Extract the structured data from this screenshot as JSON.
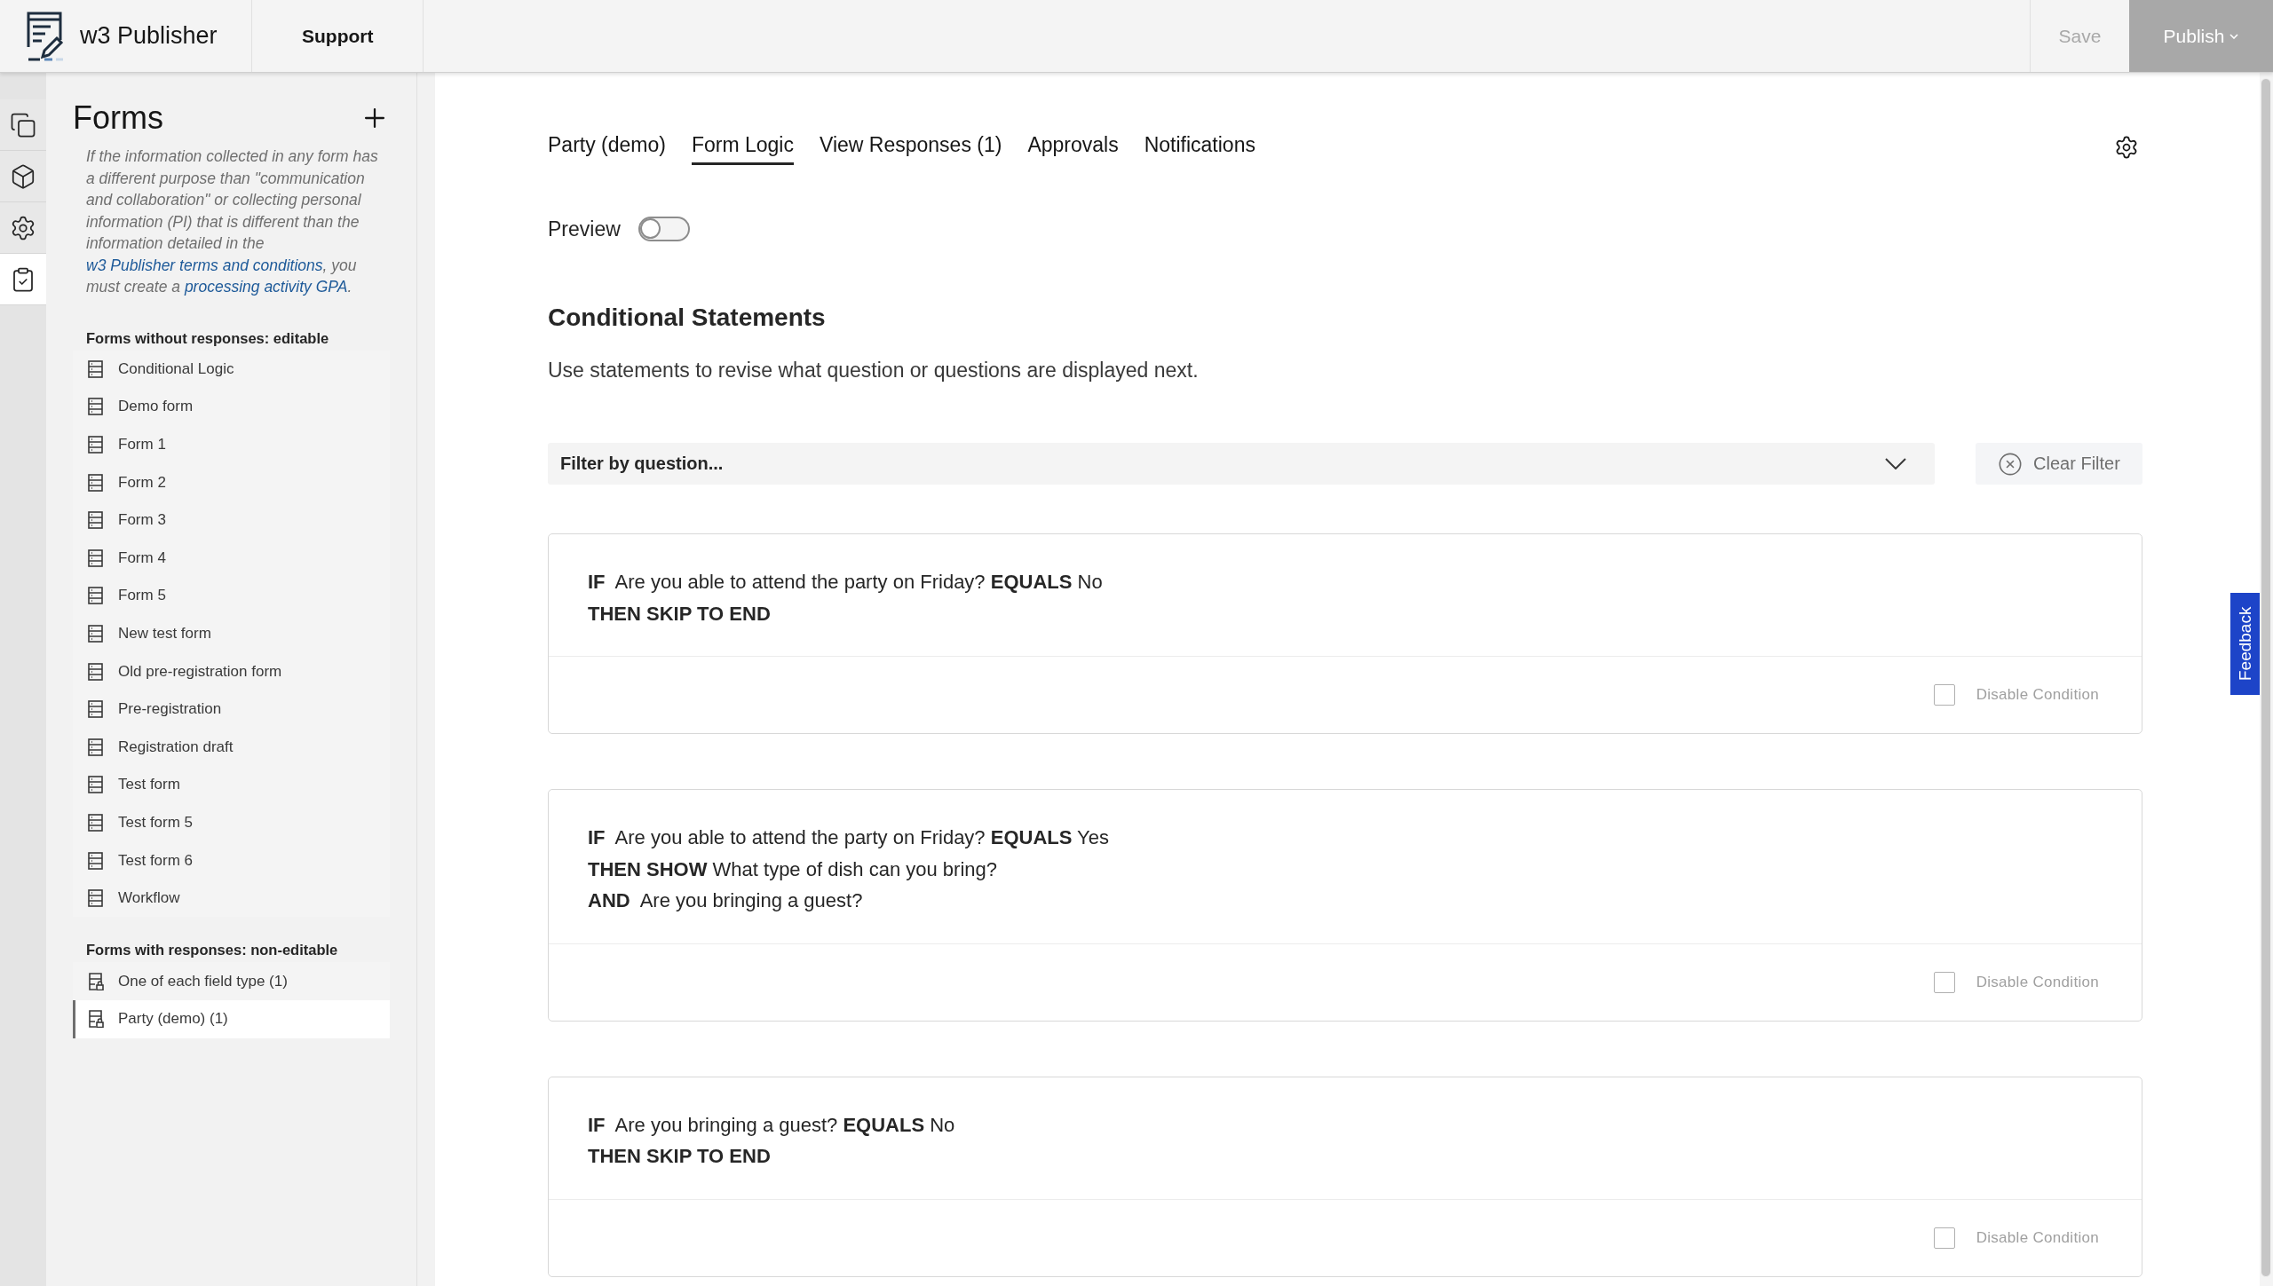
{
  "app": {
    "name": "w3 Publisher"
  },
  "header_nav": [
    {
      "label": "Support"
    }
  ],
  "header_actions": {
    "save": {
      "label": "Save",
      "disabled": true
    },
    "publish": {
      "label": "Publish"
    }
  },
  "rail": [
    {
      "kind": "pages",
      "selected": false
    },
    {
      "kind": "components",
      "selected": false
    },
    {
      "kind": "settings",
      "selected": false
    },
    {
      "kind": "forms",
      "selected": true
    }
  ],
  "sidebar": {
    "title": "Forms",
    "notice": [
      {
        "kind": "plain",
        "text": "If the information collected in any form has a different purpose than \"communication and collaboration\" or collecting personal information (PI) that is different than the information detailed in the "
      },
      {
        "kind": "link",
        "text": "w3 Publisher terms and conditions"
      },
      {
        "kind": "plain",
        "text": ", you must create a "
      },
      {
        "kind": "link",
        "text": "processing activity GPA"
      },
      {
        "kind": "plain",
        "text": "."
      }
    ],
    "sections": [
      {
        "title": "Forms without responses: editable",
        "kind": "editable",
        "items": [
          {
            "label": "Conditional Logic",
            "selected": false
          },
          {
            "label": "Demo form",
            "selected": false
          },
          {
            "label": "Form 1",
            "selected": false
          },
          {
            "label": "Form 2",
            "selected": false
          },
          {
            "label": "Form 3",
            "selected": false
          },
          {
            "label": "Form 4",
            "selected": false
          },
          {
            "label": "Form 5",
            "selected": false
          },
          {
            "label": "New test form",
            "selected": false
          },
          {
            "label": "Old pre-registration form",
            "selected": false
          },
          {
            "label": "Pre-registration",
            "selected": false
          },
          {
            "label": "Registration draft",
            "selected": false
          },
          {
            "label": "Test form",
            "selected": false
          },
          {
            "label": "Test form 5",
            "selected": false
          },
          {
            "label": "Test form 6",
            "selected": false
          },
          {
            "label": "Workflow",
            "selected": false
          }
        ]
      },
      {
        "title": "Forms with responses: non-editable",
        "kind": "locked",
        "items": [
          {
            "label": "One of each field type (1)",
            "selected": false
          },
          {
            "label": "Party (demo) (1)",
            "selected": true
          }
        ]
      }
    ]
  },
  "tabs": [
    {
      "label": "Party (demo)",
      "selected": false
    },
    {
      "label": "Form Logic",
      "selected": true
    },
    {
      "label": "View Responses (1)",
      "selected": false
    },
    {
      "label": "Approvals",
      "selected": false
    },
    {
      "label": "Notifications",
      "selected": false
    }
  ],
  "preview": {
    "label": "Preview",
    "on": false
  },
  "section": {
    "title": "Conditional Statements",
    "description": "Use statements to revise what question or questions are displayed next."
  },
  "filter": {
    "placeholder": "Filter by question...",
    "clear_label": "Clear Filter"
  },
  "statements": [
    {
      "lines": [
        "**IF**  Are you able to attend the party on Friday? **EQUALS** No",
        "**THEN SKIP TO END**"
      ],
      "disable": {
        "label": "Disable Condition",
        "checked": false
      }
    },
    {
      "lines": [
        "**IF**  Are you able to attend the party on Friday? **EQUALS** Yes",
        "**THEN SHOW** What type of dish can you bring?",
        "**AND**  Are you bringing a guest?"
      ],
      "disable": {
        "label": "Disable Condition",
        "checked": false
      }
    },
    {
      "lines": [
        "**IF**  Are you bringing a guest? **EQUALS** No",
        "**THEN SKIP TO END**"
      ],
      "disable": {
        "label": "Disable Condition",
        "checked": false
      }
    }
  ],
  "feedback": {
    "label": "Feedback"
  }
}
